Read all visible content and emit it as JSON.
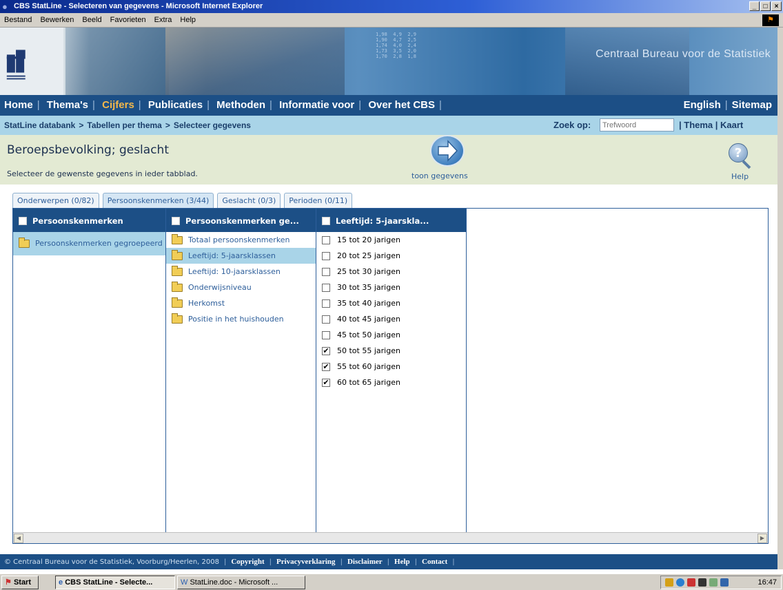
{
  "window": {
    "title": "CBS StatLine - Selecteren van gegevens - Microsoft Internet Explorer",
    "controls": [
      "_",
      "□",
      "×"
    ]
  },
  "menubar": [
    "Bestand",
    "Bewerken",
    "Beeld",
    "Favorieten",
    "Extra",
    "Help"
  ],
  "banner": {
    "brand": "Centraal Bureau voor de Statistiek",
    "numbers": "1,98  4,9  2,9\n1,90  4,7  2,5\n1,74  4,0  2,4\n1,73  3,5  2,0\n1,70  2,8  1,8"
  },
  "nav": {
    "items": [
      {
        "label": "Home",
        "active": false
      },
      {
        "label": "Thema's",
        "active": false
      },
      {
        "label": "Cijfers",
        "active": true
      },
      {
        "label": "Publicaties",
        "active": false
      },
      {
        "label": "Methoden",
        "active": false
      },
      {
        "label": "Informatie voor",
        "active": false
      },
      {
        "label": "Over het CBS",
        "active": false
      }
    ],
    "right": [
      "English",
      "Sitemap"
    ]
  },
  "breadcrumb": [
    "StatLine databank",
    "Tabellen per thema",
    "Selecteer gegevens"
  ],
  "search": {
    "label": "Zoek op:",
    "placeholder": "Trefwoord",
    "links": "| Thema | Kaart"
  },
  "page": {
    "title": "Beroepsbevolking; geslacht",
    "instruction": "Selecteer de gewenste gegevens in ieder tabblad.",
    "show_label": "toon gegevens",
    "help_label": "Help"
  },
  "tabs": [
    {
      "label": "Onderwerpen (0/82)",
      "active": false
    },
    {
      "label": "Persoonskenmerken (3/44)",
      "active": true
    },
    {
      "label": "Geslacht (0/3)",
      "active": false
    },
    {
      "label": "Perioden (0/11)",
      "active": false
    }
  ],
  "columns": {
    "col1": {
      "header": "Persoonskenmerken",
      "items": [
        {
          "label": "Persoonskenmerken gegroepeerd",
          "selected": true
        }
      ]
    },
    "col2": {
      "header": "Persoonskenmerken ge...",
      "items": [
        {
          "label": "Totaal persoonskenmerken",
          "selected": false
        },
        {
          "label": "Leeftijd: 5-jaarsklassen",
          "selected": true
        },
        {
          "label": "Leeftijd: 10-jaarsklassen",
          "selected": false
        },
        {
          "label": "Onderwijsniveau",
          "selected": false
        },
        {
          "label": "Herkomst",
          "selected": false
        },
        {
          "label": "Positie in het huishouden",
          "selected": false
        }
      ]
    },
    "col3": {
      "header": "Leeftijd: 5-jaarskla...",
      "items": [
        {
          "label": "15 tot 20 jarigen",
          "checked": false
        },
        {
          "label": "20 tot 25 jarigen",
          "checked": false
        },
        {
          "label": "25 tot 30 jarigen",
          "checked": false
        },
        {
          "label": "30 tot 35 jarigen",
          "checked": false
        },
        {
          "label": "35 tot 40 jarigen",
          "checked": false
        },
        {
          "label": "40 tot 45 jarigen",
          "checked": false
        },
        {
          "label": "45 tot 50 jarigen",
          "checked": false
        },
        {
          "label": "50 tot 55 jarigen",
          "checked": true
        },
        {
          "label": "55 tot 60 jarigen",
          "checked": true
        },
        {
          "label": "60 tot 65 jarigen",
          "checked": true
        }
      ]
    }
  },
  "footer": {
    "copyright": "© Centraal Bureau voor de Statistiek, Voorburg/Heerlen, 2008",
    "links": [
      "Copyright",
      "Privacyverklaring",
      "Disclaimer",
      "Help",
      "Contact"
    ]
  },
  "taskbar": {
    "start": "Start",
    "tasks": [
      {
        "label": "CBS StatLine - Selecte...",
        "active": true
      },
      {
        "label": "StatLine.doc - Microsoft ...",
        "active": false
      }
    ],
    "clock": "16:47"
  },
  "colors": {
    "nav_bg": "#1c4f86",
    "crumb_bg": "#a9d4e8",
    "title_bg": "#e3ead3",
    "active_nav": "#f5b84a",
    "link": "#2d5e9a"
  }
}
